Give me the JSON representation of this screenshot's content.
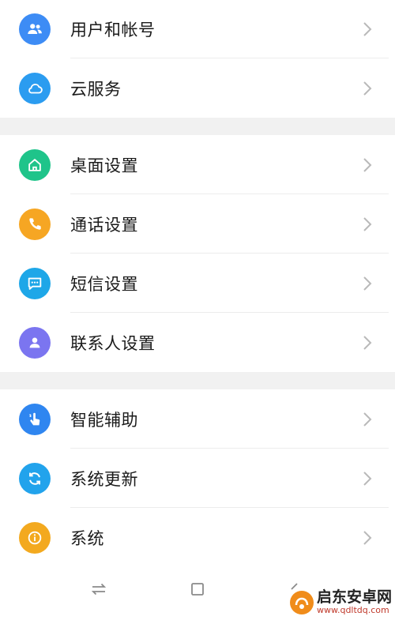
{
  "groups": [
    {
      "items": [
        {
          "label": "用户和帐号",
          "color": "#3d8cf5",
          "icon": "users-icon"
        },
        {
          "label": "云服务",
          "color": "#2b9cf0",
          "icon": "cloud-icon"
        }
      ]
    },
    {
      "items": [
        {
          "label": "桌面设置",
          "color": "#1fc48a",
          "icon": "home-icon"
        },
        {
          "label": "通话设置",
          "color": "#f6a623",
          "icon": "phone-icon"
        },
        {
          "label": "短信设置",
          "color": "#1ea7e8",
          "icon": "message-icon"
        },
        {
          "label": "联系人设置",
          "color": "#7b75f0",
          "icon": "person-icon"
        }
      ]
    },
    {
      "items": [
        {
          "label": "智能辅助",
          "color": "#2f86f0",
          "icon": "hand-pointer-icon"
        },
        {
          "label": "系统更新",
          "color": "#22a3ec",
          "icon": "refresh-icon"
        },
        {
          "label": "系统",
          "color": "#f3a91f",
          "icon": "info-icon"
        }
      ]
    }
  ],
  "watermark": {
    "title": "启东安卓网",
    "url": "www.qdltdq.com"
  }
}
